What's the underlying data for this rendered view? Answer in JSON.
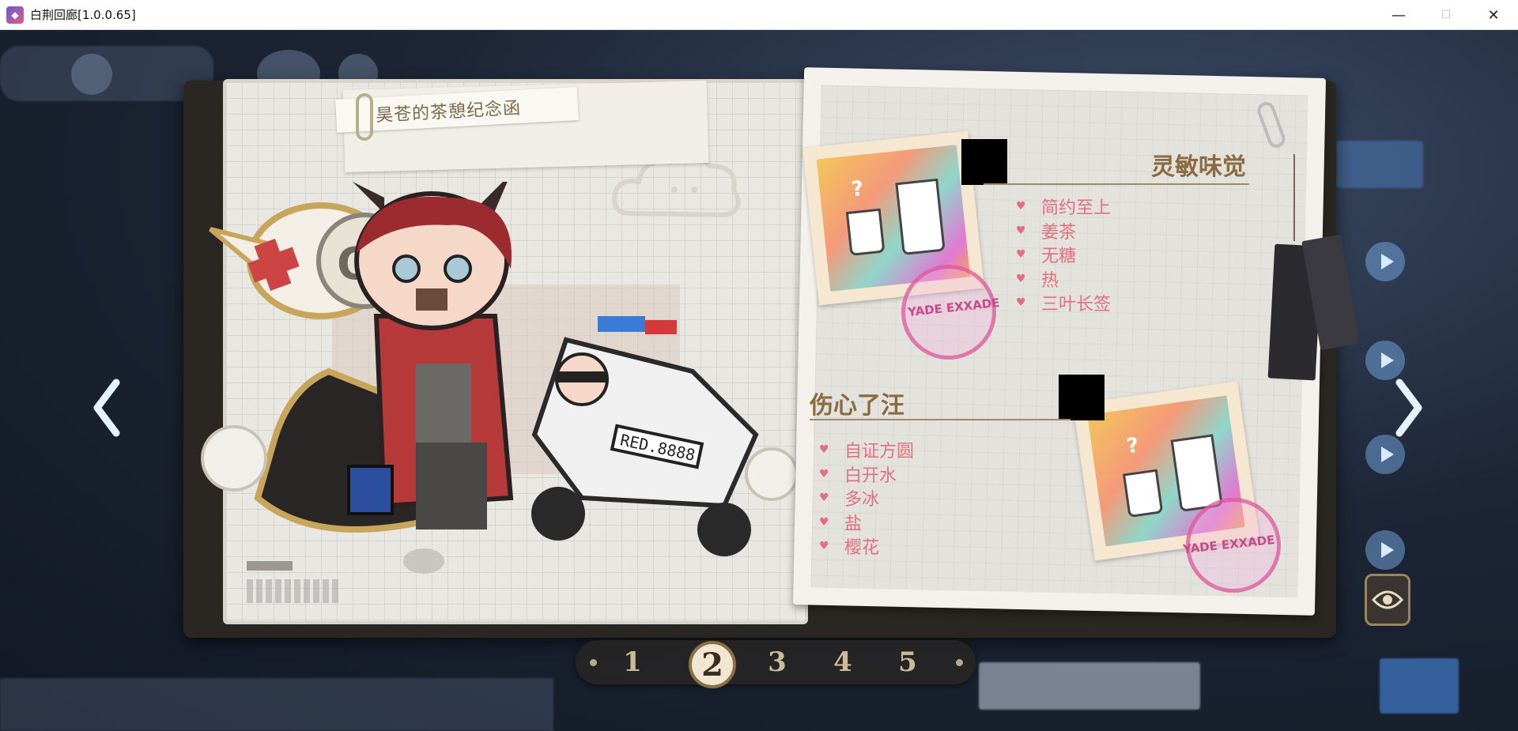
{
  "window": {
    "title": "白荆回廊[1.0.0.65]",
    "minimize": "—",
    "maximize": "☐",
    "close": "✕"
  },
  "letter": {
    "title": "昊苍的茶憩纪念函"
  },
  "sections": [
    {
      "title": "灵敏味觉",
      "items": [
        "简约至上",
        "姜茶",
        "无糖",
        "热",
        "三叶长签"
      ]
    },
    {
      "title": "伤心了汪",
      "items": [
        "自证方圆",
        "白开水",
        "多冰",
        "盐",
        "樱花"
      ]
    }
  ],
  "artwork": {
    "speech_text": "OK",
    "license_plate": "RED.8888",
    "stamp_text": "YADE EXXADE"
  },
  "pager": {
    "pages": [
      "1",
      "2",
      "3",
      "4",
      "5"
    ],
    "current": "2"
  },
  "colors": {
    "accent_pink": "#e0707f",
    "heading_brown": "#8a6a40",
    "pager_active": "#f0e6d2"
  },
  "icons": {
    "eye": "eye-icon",
    "prev": "chevron-left-icon",
    "next": "chevron-right-icon"
  }
}
